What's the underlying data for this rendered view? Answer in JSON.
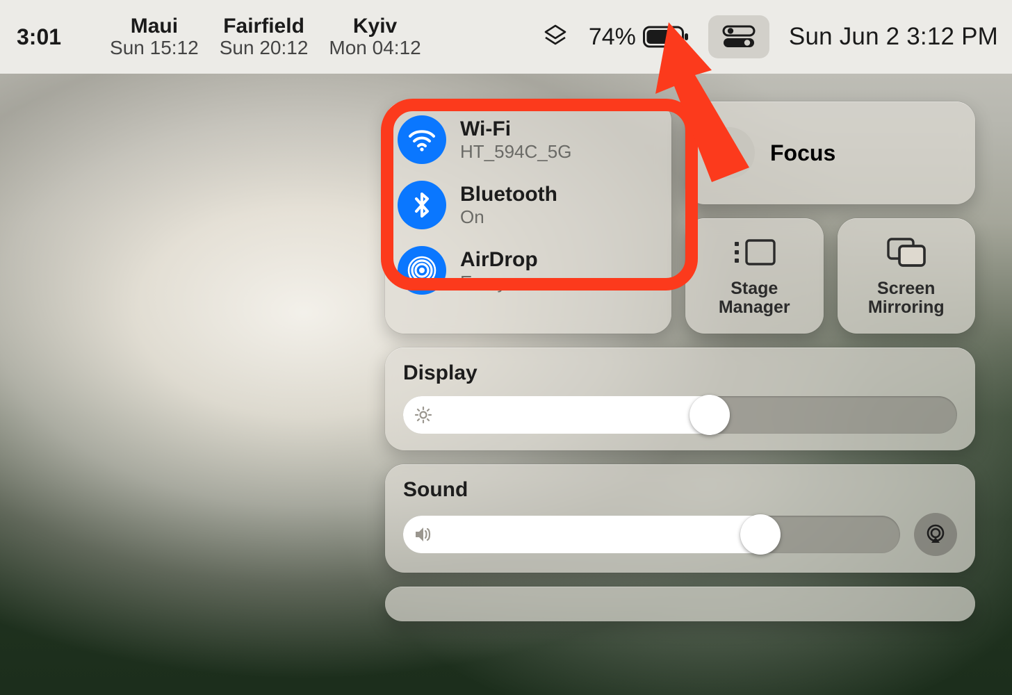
{
  "menubar": {
    "local_clock": "3:01",
    "world_clocks": [
      {
        "city": "Maui",
        "time": "Sun 15:12"
      },
      {
        "city": "Fairfield",
        "time": "Sun 20:12"
      },
      {
        "city": "Kyiv",
        "time": "Mon 04:12"
      }
    ],
    "battery_pct": "74%",
    "date_time": "Sun Jun 2  3:12 PM"
  },
  "control_center": {
    "wifi": {
      "title": "Wi-Fi",
      "sub": "HT_594C_5G"
    },
    "bluetooth": {
      "title": "Bluetooth",
      "sub": "On"
    },
    "airdrop": {
      "title": "AirDrop",
      "sub": "Everyone"
    },
    "focus_label": "Focus",
    "stage_manager_label": "Stage\nManager",
    "screen_mirroring_label": "Screen\nMirroring",
    "display_label": "Display",
    "sound_label": "Sound",
    "display_value_pct": 59,
    "sound_value_pct": 76
  },
  "colors": {
    "accent_blue": "#0a77ff",
    "annotation_red": "#fc3a1c"
  }
}
